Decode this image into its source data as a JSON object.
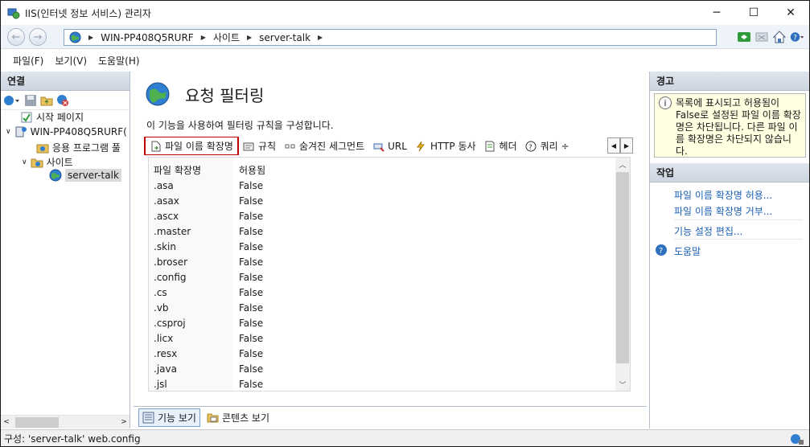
{
  "window": {
    "title": "IIS(인터넷 정보 서비스) 관리자",
    "minimize": "─",
    "maximize": "☐",
    "close": "✕"
  },
  "addressbar": {
    "crumbs": [
      "WIN-PP408Q5RURF",
      "사이트",
      "server-talk"
    ]
  },
  "menu": [
    "파일(F)",
    "보기(V)",
    "도움말(H)"
  ],
  "connections": {
    "header": "연결",
    "tree": {
      "start_page": "시작 페이지",
      "server": "WIN-PP408Q5RURF(",
      "app_pools": "응용 프로그램 풀",
      "sites": "사이트",
      "site": "server-talk"
    }
  },
  "main": {
    "title": "요청 필터링",
    "description": "이 기능을 사용하여 필터링 규칙을 구성합니다.",
    "tabs": [
      "파일 이름 확장명",
      "규칙",
      "숨겨진 세그먼트",
      "URL",
      "HTTP 동사",
      "헤더",
      "쿼리 ÷"
    ],
    "columns": [
      "파일 확장명",
      "허용됨"
    ],
    "rows": [
      [
        ".asa",
        "False"
      ],
      [
        ".asax",
        "False"
      ],
      [
        ".ascx",
        "False"
      ],
      [
        ".master",
        "False"
      ],
      [
        ".skin",
        "False"
      ],
      [
        ".broser",
        "False"
      ],
      [
        ".config",
        "False"
      ],
      [
        ".cs",
        "False"
      ],
      [
        ".vb",
        "False"
      ],
      [
        ".csproj",
        "False"
      ],
      [
        ".licx",
        "False"
      ],
      [
        ".resx",
        "False"
      ],
      [
        ".java",
        "False"
      ],
      [
        ".jsl",
        "False"
      ]
    ],
    "views": [
      "기능 보기",
      "콘텐츠 보기"
    ]
  },
  "alerts": {
    "header": "경고",
    "message": "목록에 표시되고 허용됨이 False로 설정된 파일 이름 확장명은 차단됩니다. 다른 파일 이름 확장명은 차단되지 않습니다."
  },
  "actions": {
    "header": "작업",
    "allow": "파일 이름 확장명 허용...",
    "deny": "파일 이름 확장명 거부...",
    "edit_settings": "기능 설정 편집...",
    "help": "도움말"
  },
  "status": {
    "text": "구성: 'server-talk' web.config"
  },
  "colors": {
    "active_tab_border": "#c00000",
    "link": "#1a5fb4",
    "alert_bg": "#ffffe1",
    "panel_header": "#cdd5e1"
  }
}
